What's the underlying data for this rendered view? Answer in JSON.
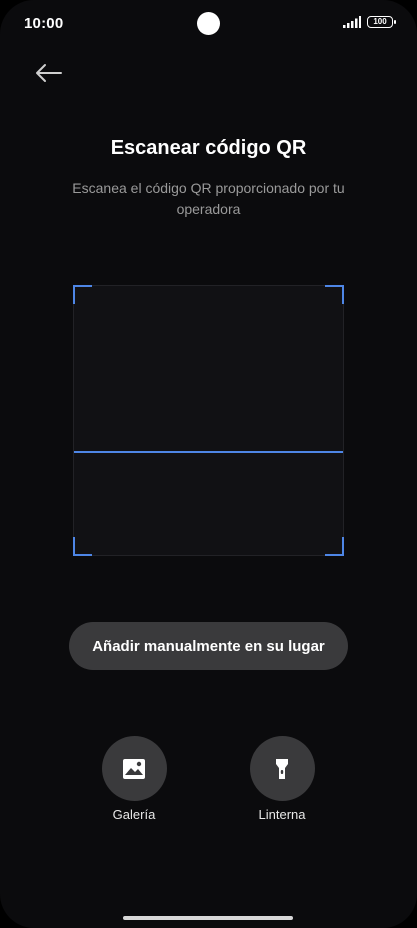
{
  "status_bar": {
    "time": "10:00",
    "battery_level": "100",
    "signal_icon": "signal-bars-icon"
  },
  "header": {
    "back_icon": "arrow-left-icon",
    "title": "Escanear código QR",
    "subtitle": "Escanea el código QR proporcionado por tu operadora"
  },
  "scanner": {
    "accent_color": "#4e86e6"
  },
  "manual_button": {
    "label": "Añadir manualmente en su lugar"
  },
  "actions": [
    {
      "label": "Galería",
      "icon": "image-icon"
    },
    {
      "label": "Linterna",
      "icon": "flashlight-icon"
    }
  ]
}
